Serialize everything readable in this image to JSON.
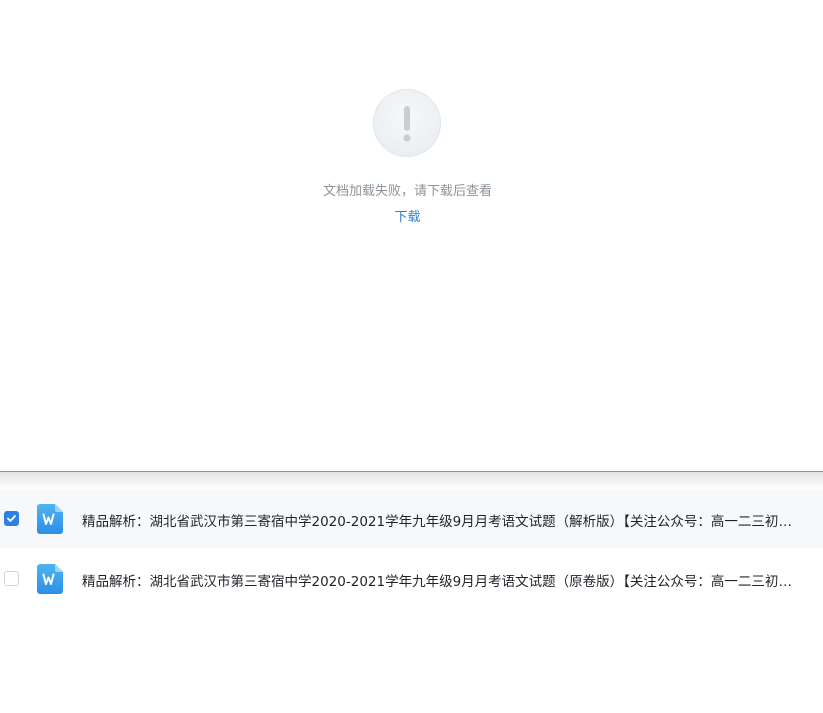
{
  "preview": {
    "error_icon": "exclamation-icon",
    "error_message": "文档加载失败，请下载后查看",
    "download_label": "下载"
  },
  "files": [
    {
      "checked": true,
      "icon": "word-doc-icon",
      "name": "精品解析：湖北省武汉市第三寄宿中学2020-2021学年九年级9月月考语文试题（解析版）【关注公众号：高一二三初一二三…"
    },
    {
      "checked": false,
      "icon": "word-doc-icon",
      "name": "精品解析：湖北省武汉市第三寄宿中学2020-2021学年九年级9月月考语文试题（原卷版）【关注公众号：高一二三初一二三…"
    }
  ],
  "colors": {
    "accent": "#2f80e4",
    "link": "#2f7fd8",
    "word_icon_top": "#4fb4f0",
    "word_icon_bottom": "#2d8ee8"
  }
}
